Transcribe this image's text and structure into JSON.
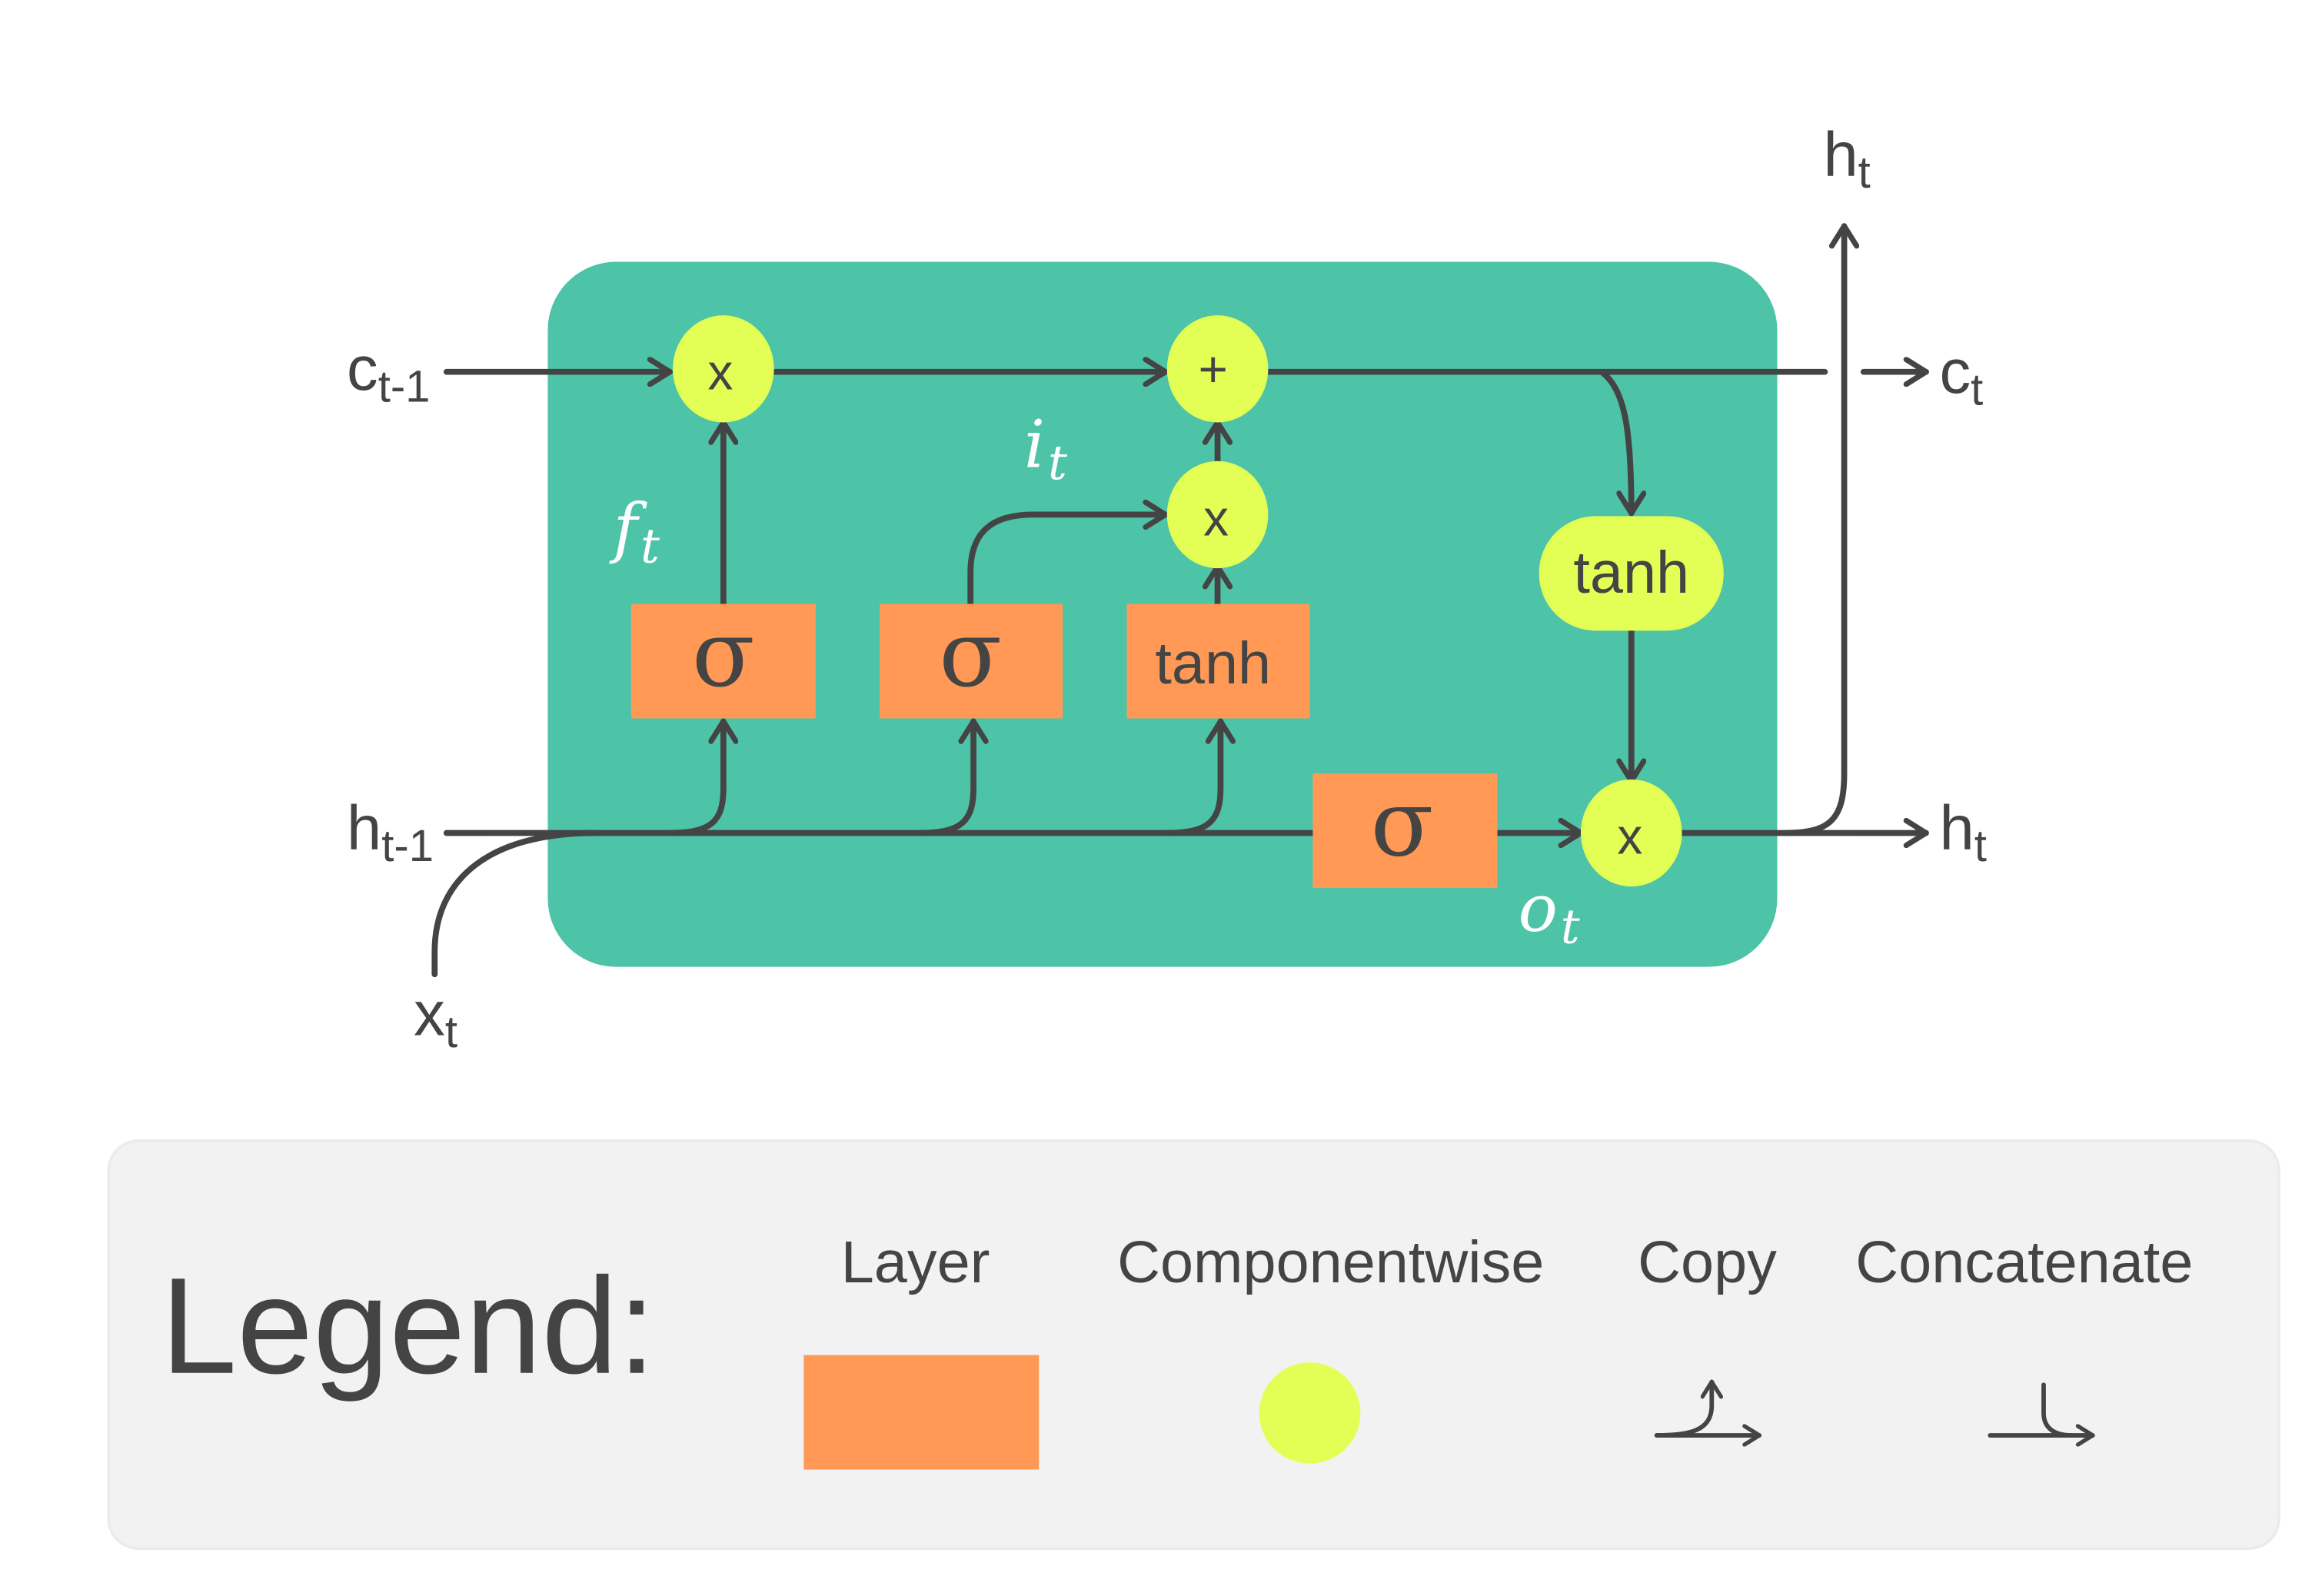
{
  "colors": {
    "cell_background": "#4DC3A8",
    "layer": "#FF9955",
    "pointwise": "#E3FF55",
    "wire": "#444444",
    "legend_background": "#F2F2F2",
    "gate_label": "#FFFFFF"
  },
  "inputs": {
    "c_prev": {
      "base": "c",
      "sub": "t-1"
    },
    "h_prev": {
      "base": "h",
      "sub": "t-1"
    },
    "x": {
      "base": "x",
      "sub": "t"
    }
  },
  "outputs": {
    "c_out": {
      "base": "c",
      "sub": "t"
    },
    "h_out_right": {
      "base": "h",
      "sub": "t"
    },
    "h_out_top": {
      "base": "h",
      "sub": "t"
    }
  },
  "gates": {
    "forget": {
      "base": "f",
      "sub": "t"
    },
    "input": {
      "base": "i",
      "sub": "t"
    },
    "output": {
      "base": "o",
      "sub": "t"
    }
  },
  "layers": {
    "forget_sigma": "σ",
    "input_sigma": "σ",
    "candidate_tanh": "tanh",
    "output_sigma": "σ"
  },
  "pointwise_ops": {
    "forget_mult": "x",
    "cell_add": "+",
    "input_mult": "x",
    "cell_tanh": "tanh",
    "output_mult": "x"
  },
  "legend": {
    "title": "Legend:",
    "items": [
      {
        "label": "Layer",
        "icon": "orange-rectangle"
      },
      {
        "label": "Componentwise",
        "icon": "yellow-circle"
      },
      {
        "label": "Copy",
        "icon": "copy-arrow-icon"
      },
      {
        "label": "Concatenate",
        "icon": "concatenate-arrow-icon"
      }
    ]
  }
}
